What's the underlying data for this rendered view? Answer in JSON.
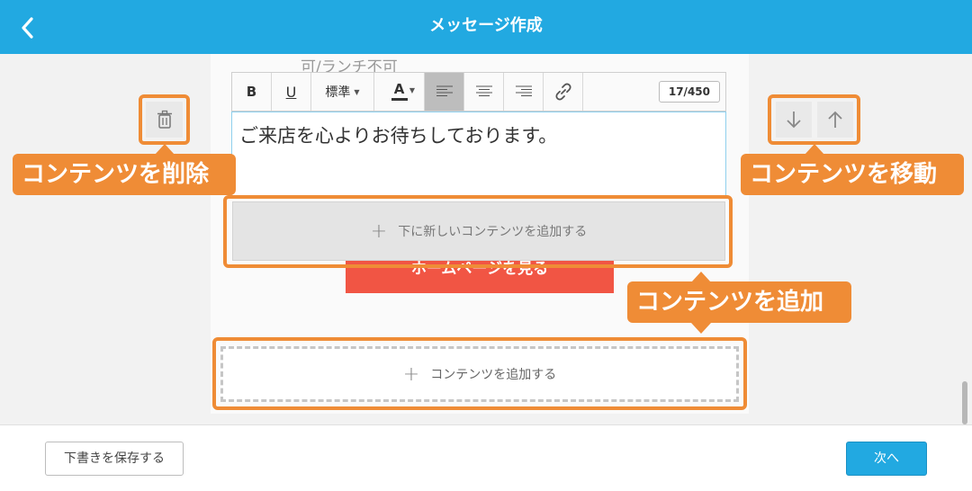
{
  "header": {
    "title": "メッセージ作成"
  },
  "content": {
    "faded_text": "可/ランチ不可",
    "editor_text": "ご来店を心よりお待ちしております。",
    "red_button_label": "ホームページを見る"
  },
  "toolbar": {
    "bold": "B",
    "underline": "U",
    "size_label": "標準",
    "color_letter": "A",
    "char_counter": "17/450"
  },
  "actions": {
    "add_below_label": "下に新しいコンテンツを追加する",
    "add_content_label": "コンテンツを追加する"
  },
  "callouts": {
    "delete": "コンテンツを削除",
    "move": "コンテンツを移動",
    "add": "コンテンツを追加"
  },
  "footer": {
    "save_draft": "下書きを保存する",
    "next": "次へ"
  },
  "colors": {
    "header": "#22a9e1",
    "callout": "#ef8c36",
    "red_button": "#f15544"
  },
  "icons": [
    "back-icon",
    "trash-icon",
    "arrow-down-icon",
    "arrow-up-icon",
    "link-icon",
    "plus-icon"
  ]
}
